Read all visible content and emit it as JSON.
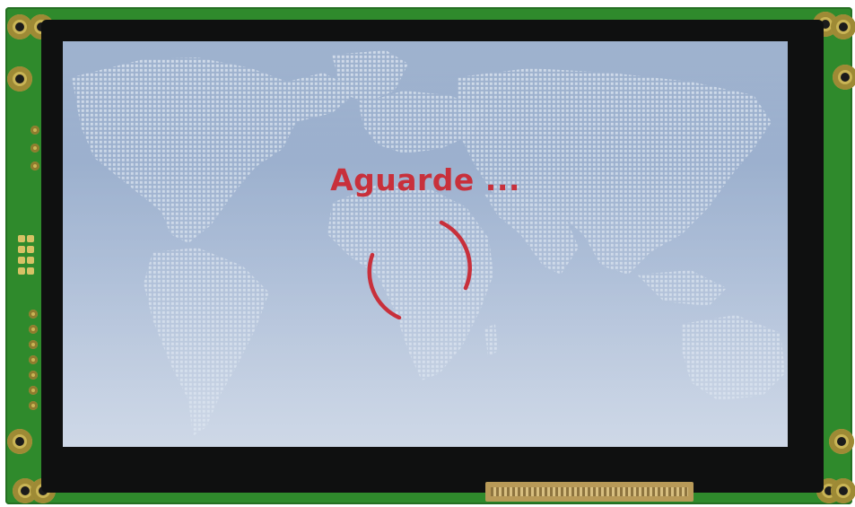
{
  "screen": {
    "loading_text": "Aguarde ...",
    "background": "world-map-dotted",
    "accent_color": "#c8303b"
  },
  "spinner": {
    "icon": "loading-spinner-icon"
  }
}
